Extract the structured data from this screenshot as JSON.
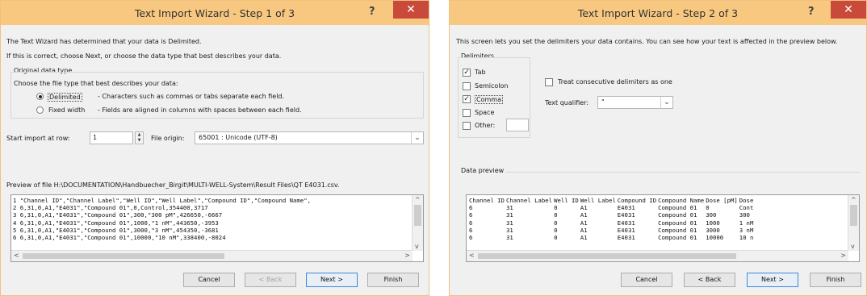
{
  "step1": {
    "title": "Text Import Wizard - Step 1 of 3",
    "help": "?",
    "close": "✕",
    "intro1": "The Text Wizard has determined that your data is Delimited.",
    "intro2": "If this is correct, choose Next, or choose the data type that best describes your data.",
    "group_label": "Original data type",
    "choose_label": "Choose the file type that best describes your data:",
    "delimited_label": "Delimited",
    "delimited_desc": "- Characters such as commas or tabs separate each field.",
    "fixed_label": "Fixed width",
    "fixed_desc": "- Fields are aligned in columns with spaces between each field.",
    "start_row_label": "Start import at row:",
    "start_row_value": "1",
    "file_origin_label": "File origin:",
    "file_origin_value": "65001 : Unicode (UTF-8)",
    "preview_label": "Preview of file H:\\DOCUMENTATION\\Handbuecher_Birgit\\MULTI-WELL-System\\Result Files\\QT E4031.csv.",
    "preview_lines": [
      "1 \"Channel ID\",\"Channel Label\",\"Well ID\",\"Well Label\",\"Compound ID\",\"Compound Name\",",
      "2 6,31,0,A1,\"E4031\",\"Compound 01\",0,Control,354400,3717",
      "3 6,31,0,A1,\"E4031\",\"Compound 01\",300,\"300 pM\",426650,-6667",
      "4 6,31,0,A1,\"E4031\",\"Compound 01\",1000,\"1 nM\",443650,-3953",
      "5 6,31,0,A1,\"E4031\",\"Compound 01\",3000,\"3 nM\",454350,-3681",
      "6 6,31,0,A1,\"E4031\",\"Compound 01\",10000,\"10 nM\",338400,-8024"
    ],
    "btn_cancel": "Cancel",
    "btn_back": "< Back",
    "btn_next": "Next >",
    "btn_finish": "Finish"
  },
  "step2": {
    "title": "Text Import Wizard - Step 2 of 3",
    "help": "?",
    "close": "✕",
    "intro": "This screen lets you set the delimiters your data contains.  You can see how your text is affected in the preview below.",
    "delimiters_label": "Delimiters",
    "tab_label": "Tab",
    "semicolon_label": "Semicolon",
    "comma_label": "Comma",
    "space_label": "Space",
    "other_label": "Other:",
    "consecutive_label": "Treat consecutive delimiters as one",
    "qualifier_label": "Text qualifier:",
    "qualifier_value": "\"",
    "data_preview_label": "Data preview",
    "checks": {
      "tab": true,
      "semicolon": false,
      "comma": true,
      "space": false,
      "other": false,
      "consecutive": false
    },
    "columns": [
      "Channel ID",
      "Channel Label",
      "Well ID",
      "Well Label",
      "Compound ID",
      "Compound Name",
      "Dose [pM]",
      "Dose"
    ],
    "rows": [
      [
        "6",
        "31",
        "0",
        "A1",
        "E4031",
        "Compound 01",
        "0",
        "Cont"
      ],
      [
        "6",
        "31",
        "0",
        "A1",
        "E4031",
        "Compound 01",
        "300",
        "300"
      ],
      [
        "6",
        "31",
        "0",
        "A1",
        "E4031",
        "Compound 01",
        "1000",
        "1 nM"
      ],
      [
        "6",
        "31",
        "0",
        "A1",
        "E4031",
        "Compound 01",
        "3000",
        "3 nM"
      ],
      [
        "6",
        "31",
        "0",
        "A1",
        "E4031",
        "Compound 01",
        "10000",
        "10 n"
      ]
    ],
    "btn_cancel": "Cancel",
    "btn_back": "< Back",
    "btn_next": "Next >",
    "btn_finish": "Finish"
  },
  "colors": {
    "titlebar": "#f8c880",
    "close": "#c94a3a",
    "window": "#f0f0f0"
  },
  "icons": {
    "help": "question-mark-icon",
    "close": "close-icon",
    "dropdown": "chevron-down-icon"
  }
}
